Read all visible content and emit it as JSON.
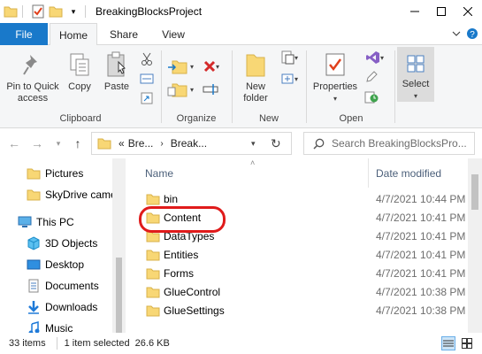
{
  "window": {
    "title": "BreakingBlocksProject"
  },
  "ribbon_tabs": [
    {
      "label": "File"
    },
    {
      "label": "Home"
    },
    {
      "label": "Share"
    },
    {
      "label": "View"
    }
  ],
  "ribbon": {
    "clipboard": {
      "pin_label_1": "Pin to Quick",
      "pin_label_2": "access",
      "copy_label": "Copy",
      "paste_label": "Paste",
      "group_label": "Clipboard"
    },
    "organize": {
      "group_label": "Organize"
    },
    "new": {
      "new_folder_label_1": "New",
      "new_folder_label_2": "folder",
      "group_label": "New"
    },
    "open": {
      "properties_label": "Properties",
      "group_label": "Open"
    },
    "select": {
      "select_label": "Select"
    }
  },
  "address": {
    "overflow": "«",
    "segments": [
      "Bre...",
      "Break..."
    ]
  },
  "search": {
    "placeholder": "Search BreakingBlocksPro..."
  },
  "nav_pane": {
    "items": [
      {
        "label": "Pictures",
        "icon": "folder-icon"
      },
      {
        "label": "SkyDrive camera roll",
        "icon": "folder-icon"
      },
      {
        "label": "This PC",
        "icon": "this-pc-icon"
      },
      {
        "label": "3D Objects",
        "icon": "3d-objects-icon"
      },
      {
        "label": "Desktop",
        "icon": "desktop-icon"
      },
      {
        "label": "Documents",
        "icon": "documents-icon"
      },
      {
        "label": "Downloads",
        "icon": "downloads-icon"
      },
      {
        "label": "Music",
        "icon": "music-icon"
      }
    ]
  },
  "file_list": {
    "columns": {
      "name": "Name",
      "date": "Date modified"
    },
    "rows": [
      {
        "name": "bin",
        "date": "4/7/2021 10:44 PM"
      },
      {
        "name": "Content",
        "date": "4/7/2021 10:41 PM"
      },
      {
        "name": "DataTypes",
        "date": "4/7/2021 10:41 PM"
      },
      {
        "name": "Entities",
        "date": "4/7/2021 10:41 PM"
      },
      {
        "name": "Forms",
        "date": "4/7/2021 10:41 PM"
      },
      {
        "name": "GlueControl",
        "date": "4/7/2021 10:38 PM"
      },
      {
        "name": "GlueSettings",
        "date": "4/7/2021 10:38 PM"
      }
    ]
  },
  "status": {
    "count": "33 items",
    "selection": "1 item selected  26.6 KB"
  },
  "colors": {
    "accent": "#1979ca",
    "folder": "#f8d775",
    "highlight": "#e01b1b"
  }
}
